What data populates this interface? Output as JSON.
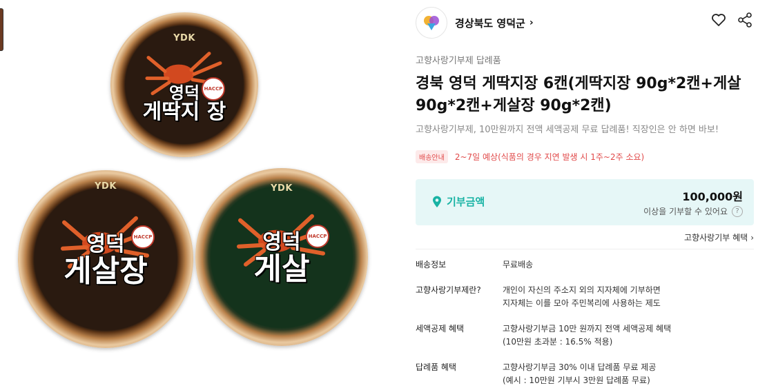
{
  "seller": {
    "name": "경상북도 영덕군",
    "chevron": "›"
  },
  "product": {
    "category": "고향사랑기부제 답례품",
    "title": "경북 영덕 게딱지장 6캔(게딱지장 90g*2캔+게살 90g*2캔+게살장 90g*2캔)",
    "subtitle": "고향사랑기부제, 10만원까지 전액 세액공제 무료 답례품! 직장인은 안 하면 바보!",
    "delivery_badge": "배송안내",
    "delivery_text": "2~7일 예상(식품의 경우 지연 발생 시 1주~2주 소요)"
  },
  "donation": {
    "label": "기부금액",
    "amount": "100,000원",
    "note": "이상을 기부할 수 있어요",
    "help": "?"
  },
  "benefit_link": {
    "label": "고향사랑기부 혜택",
    "chevron": "›"
  },
  "info": [
    {
      "label": "배송정보",
      "lines": [
        "무료배송"
      ]
    },
    {
      "label": "고향사랑기부제란?",
      "lines": [
        "개인이 자신의 주소지 외의 지자체에 기부하면",
        "지자체는 이를 모아 주민복리에 사용하는 제도"
      ]
    },
    {
      "label": "세액공제 혜택",
      "lines": [
        "고향사랑기부금 10만 원까지 전액 세액공제 혜택",
        "(10만원 초과분 : 16.5% 적용)"
      ]
    },
    {
      "label": "답례품 혜택",
      "lines": [
        "고향사랑기부금 30% 이내 답례품 무료 제공",
        "(예시 : 10만원 기부시 3만원 답례품 무료)"
      ]
    }
  ],
  "image": {
    "brand": "YDK",
    "haccp": "HACCP",
    "cans": [
      {
        "line1": "영덕",
        "line2": "게딱지 장"
      },
      {
        "line1": "영덕",
        "line2": "게살장"
      },
      {
        "line1": "영덕",
        "line2": "게살"
      }
    ]
  },
  "icons": {
    "heart": "heart-icon",
    "share": "share-icon",
    "location": "location-pin-icon"
  },
  "colors": {
    "accent": "#18b3a4",
    "donate_bg": "#e6f7f7",
    "warning": "#e14a4a"
  }
}
